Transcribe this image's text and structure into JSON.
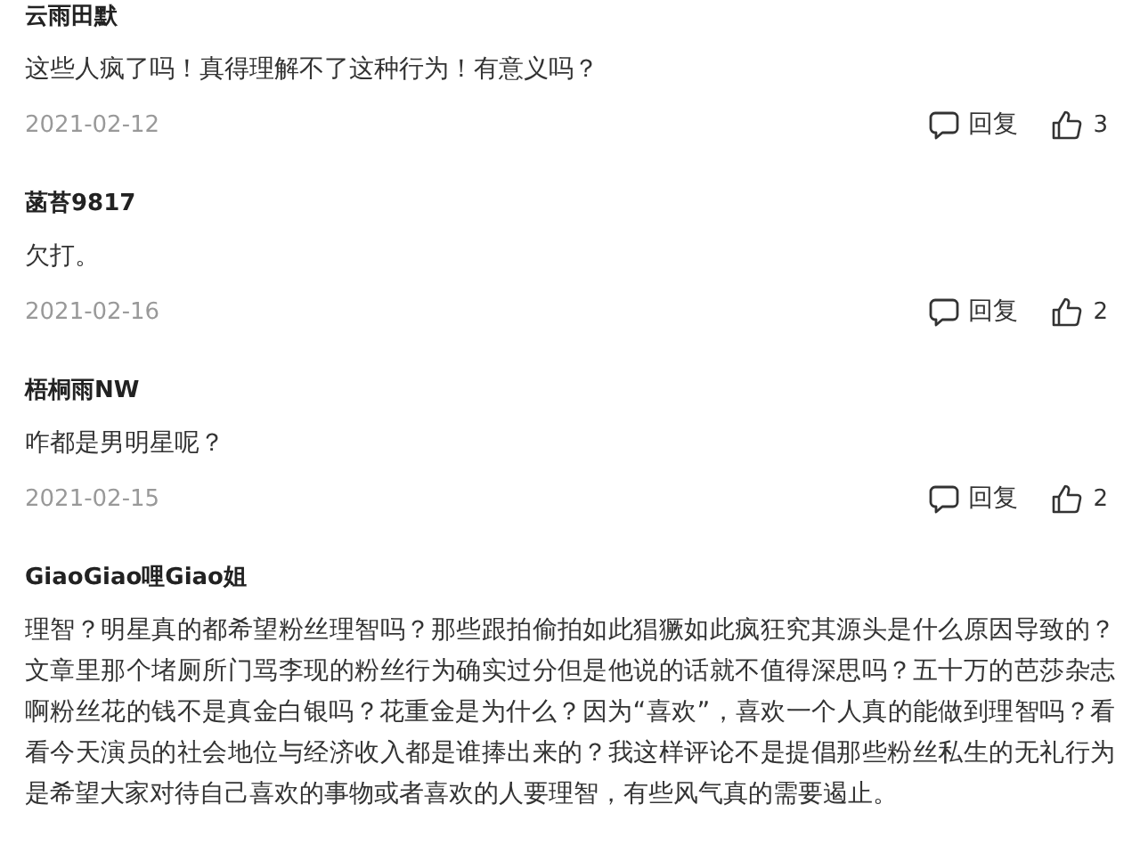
{
  "comments": [
    {
      "user": "云雨田默",
      "text": "这些人疯了吗！真得理解不了这种行为！有意义吗？",
      "date": "2021-02-12",
      "reply": "回复",
      "likes": "3"
    },
    {
      "user": "菡苔9817",
      "text": "欠打。",
      "date": "2021-02-16",
      "reply": "回复",
      "likes": "2"
    },
    {
      "user": "梧桐雨NW",
      "text": "咋都是男明星呢？",
      "date": "2021-02-15",
      "reply": "回复",
      "likes": "2"
    },
    {
      "user": "GiaoGiao哩Giao姐",
      "text": "理智？明星真的都希望粉丝理智吗？那些跟拍偷拍如此猖獗如此疯狂究其源头是什么原因导致的？文章里那个堵厕所门骂李现的粉丝行为确实过分但是他说的话就不值得深思吗？五十万的芭莎杂志啊粉丝花的钱不是真金白银吗？花重金是为什么？因为“喜欢”，喜欢一个人真的能做到理智吗？看看今天演员的社会地位与经济收入都是谁捧出来的？我这样评论不是提倡那些粉丝私生的无礼行为是希望大家对待自己喜欢的事物或者喜欢的人要理智，有些风气真的需要遏止。"
    }
  ]
}
